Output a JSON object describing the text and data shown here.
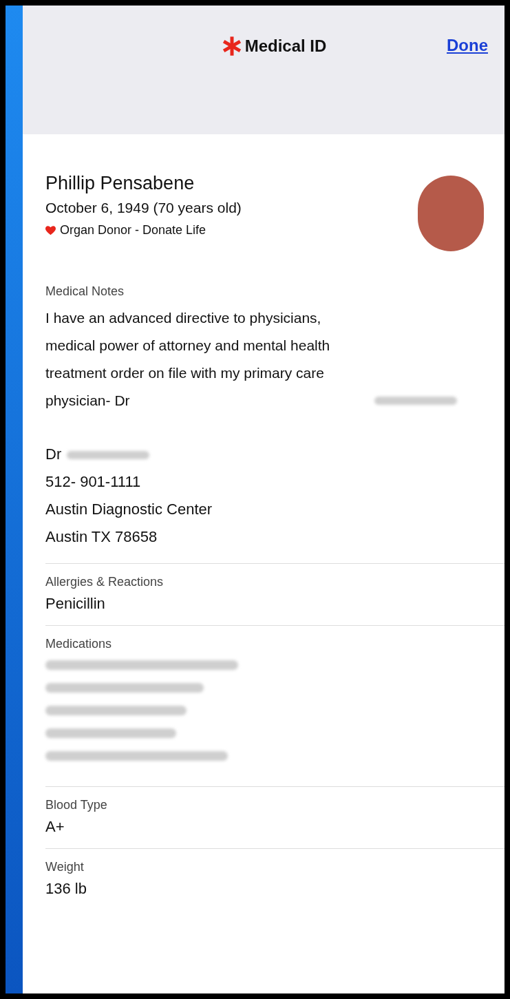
{
  "header": {
    "title": "Medical ID",
    "done": "Done"
  },
  "profile": {
    "name": "Phillip Pensabene",
    "birth": "October 6, 1949 (70 years old)",
    "organ_donor": "Organ Donor - Donate Life"
  },
  "medical_notes": {
    "label": "Medical Notes",
    "text": "I have an advanced directive to physicians, medical power of attorney and mental health treatment order on file with my primary care physician- Dr",
    "doctor_prefix": "Dr",
    "contact_lines": [
      "512- 901-1111",
      "Austin Diagnostic Center",
      "Austin TX 78658"
    ]
  },
  "sections": [
    {
      "kind": "text",
      "label": "Allergies & Reactions",
      "value": "Penicillin"
    },
    {
      "kind": "redacted",
      "label": "Medications"
    },
    {
      "kind": "text",
      "label": "Blood Type",
      "value": "A+"
    },
    {
      "kind": "text",
      "label": "Weight",
      "value": "136 lb"
    }
  ]
}
